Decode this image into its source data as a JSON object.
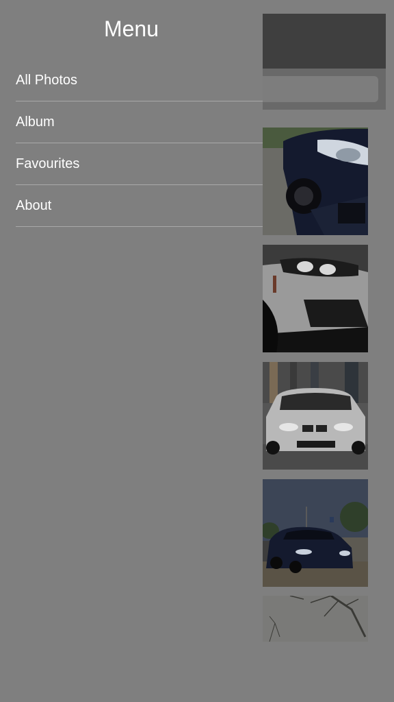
{
  "menu": {
    "title": "Menu",
    "items": [
      {
        "label": "All Photos"
      },
      {
        "label": "Album"
      },
      {
        "label": "Favourites"
      },
      {
        "label": "About"
      }
    ]
  },
  "colors": {
    "overlay": "#7f7f7f",
    "header": "#3f3f3f",
    "divider": "#a9a9a9",
    "text": "#ffffff"
  },
  "thumbnails": [
    {
      "icon": "car-photo-icon"
    },
    {
      "icon": "car-photo-icon"
    },
    {
      "icon": "car-photo-icon"
    },
    {
      "icon": "car-photo-icon"
    },
    {
      "icon": "tree-photo-icon"
    }
  ]
}
